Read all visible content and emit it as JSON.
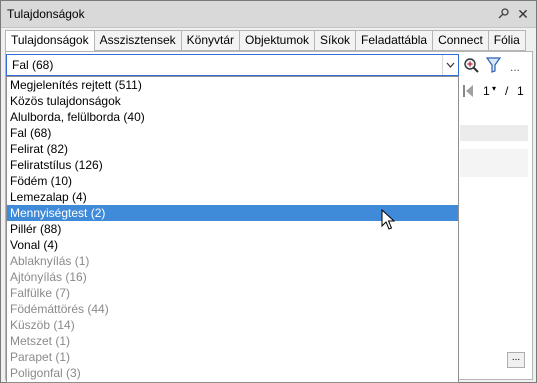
{
  "window": {
    "title": "Tulajdonságok"
  },
  "tabs": [
    {
      "label": "Tulajdonságok",
      "active": true
    },
    {
      "label": "Asszisztensek",
      "active": false
    },
    {
      "label": "Könyvtár",
      "active": false
    },
    {
      "label": "Objektumok",
      "active": false
    },
    {
      "label": "Síkok",
      "active": false
    },
    {
      "label": "Feladattábla",
      "active": false
    },
    {
      "label": "Connect",
      "active": false
    },
    {
      "label": "Fólia",
      "active": false
    }
  ],
  "combo": {
    "value": "Fal (68)"
  },
  "pager": {
    "current": "1",
    "separator": "/",
    "total": "1"
  },
  "more_label": "...",
  "dots_label": "...",
  "dropdown": {
    "items": [
      {
        "label": "Megjelenítés rejtett (511)",
        "state": "normal"
      },
      {
        "label": "Közös tulajdonságok",
        "state": "normal"
      },
      {
        "label": "Alulborda, felülborda (40)",
        "state": "normal"
      },
      {
        "label": "Fal (68)",
        "state": "normal"
      },
      {
        "label": "Felirat (82)",
        "state": "normal"
      },
      {
        "label": "Feliratstílus (126)",
        "state": "normal"
      },
      {
        "label": "Födém (10)",
        "state": "normal"
      },
      {
        "label": "Lemezalap (4)",
        "state": "normal"
      },
      {
        "label": "Mennyiségtest (2)",
        "state": "selected"
      },
      {
        "label": "Pillér (88)",
        "state": "normal"
      },
      {
        "label": "Vonal (4)",
        "state": "normal"
      },
      {
        "label": "Ablaknyílás (1)",
        "state": "disabled"
      },
      {
        "label": "Ajtónyílás (16)",
        "state": "disabled"
      },
      {
        "label": "Falfülke (7)",
        "state": "disabled"
      },
      {
        "label": "Födémáttörés (44)",
        "state": "disabled"
      },
      {
        "label": "Küszöb (14)",
        "state": "disabled"
      },
      {
        "label": "Metszet (1)",
        "state": "disabled"
      },
      {
        "label": "Parapet (1)",
        "state": "disabled"
      },
      {
        "label": "Poligonfal (3)",
        "state": "disabled"
      }
    ]
  },
  "colors": {
    "selection": "#3f8bd9",
    "disabled_text": "#8a8a8a",
    "combo_border": "#2f6fd6"
  },
  "icons": [
    "pin-icon",
    "close-icon",
    "chevron-down-icon",
    "zoom-select-icon",
    "filter-icon",
    "pager-icon",
    "mouse-cursor-icon"
  ]
}
